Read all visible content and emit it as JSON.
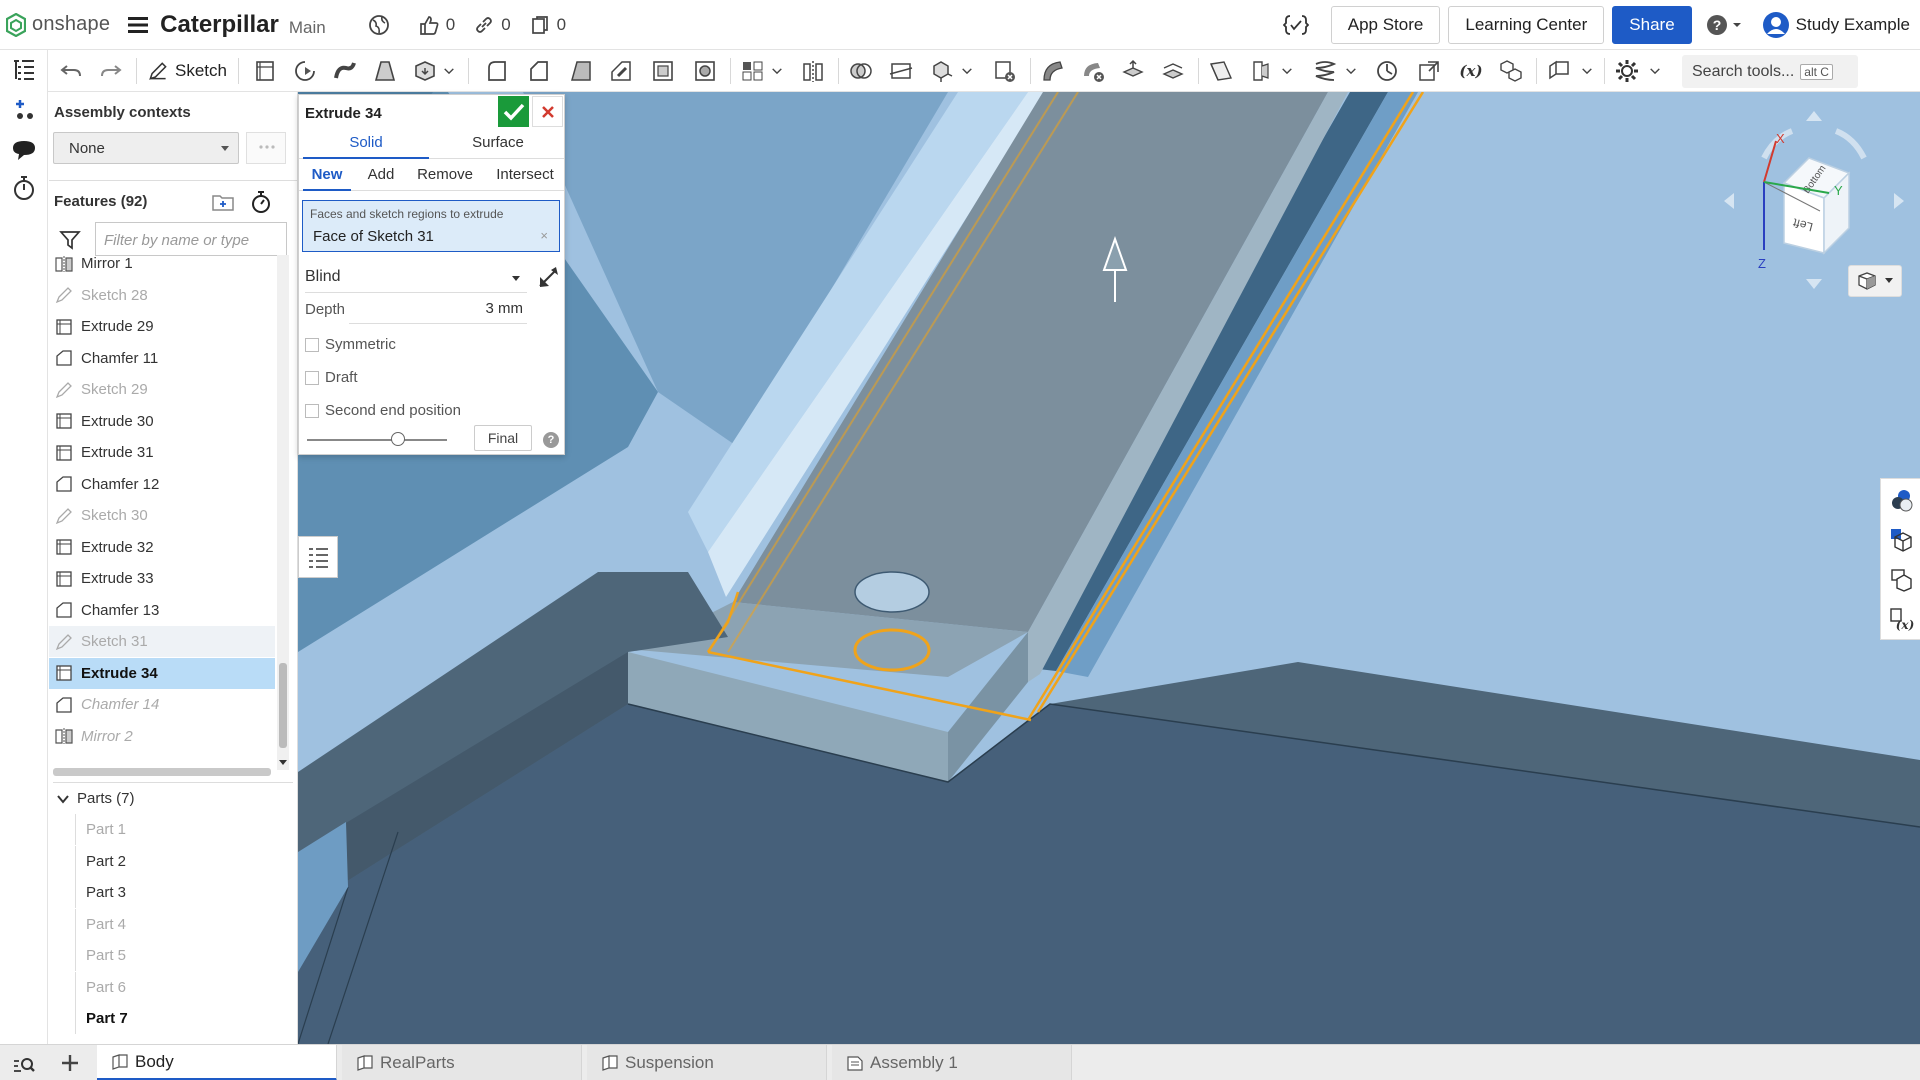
{
  "app": {
    "brand": "onshape",
    "doc_title": "Caterpillar",
    "branch": "Main"
  },
  "stats": {
    "likes": "0",
    "links": "0",
    "copies": "0"
  },
  "top_right": {
    "app_store": "App Store",
    "learning_center": "Learning Center",
    "share": "Share",
    "user": "Study Example"
  },
  "toolbar": {
    "sketch_label": "Sketch",
    "search_placeholder": "Search tools...",
    "search_shortcut": "alt C"
  },
  "panel": {
    "assembly_contexts_label": "Assembly contexts",
    "assembly_context_value": "None",
    "features_label": "Features (92)",
    "filter_placeholder": "Filter by name or type",
    "features": [
      {
        "name": "Mirror 1",
        "type": "mirror",
        "state": "normal"
      },
      {
        "name": "Sketch 28",
        "type": "sketch",
        "state": "suppressed"
      },
      {
        "name": "Extrude 29",
        "type": "extrude",
        "state": "normal"
      },
      {
        "name": "Chamfer 11",
        "type": "chamfer",
        "state": "normal"
      },
      {
        "name": "Sketch 29",
        "type": "sketch",
        "state": "suppressed"
      },
      {
        "name": "Extrude 30",
        "type": "extrude",
        "state": "normal"
      },
      {
        "name": "Extrude 31",
        "type": "extrude",
        "state": "normal"
      },
      {
        "name": "Chamfer 12",
        "type": "chamfer",
        "state": "normal"
      },
      {
        "name": "Sketch 30",
        "type": "sketch",
        "state": "suppressed"
      },
      {
        "name": "Extrude 32",
        "type": "extrude",
        "state": "normal"
      },
      {
        "name": "Extrude 33",
        "type": "extrude",
        "state": "normal"
      },
      {
        "name": "Chamfer 13",
        "type": "chamfer",
        "state": "normal"
      },
      {
        "name": "Sketch 31",
        "type": "sketch",
        "state": "hover"
      },
      {
        "name": "Extrude 34",
        "type": "extrude",
        "state": "selected"
      },
      {
        "name": "Chamfer 14",
        "type": "chamfer",
        "state": "rollback"
      },
      {
        "name": "Mirror 2",
        "type": "mirror",
        "state": "rollback"
      }
    ],
    "parts_label": "Parts (7)",
    "parts": [
      {
        "name": "Part 1",
        "state": "inactive"
      },
      {
        "name": "Part 2",
        "state": "active"
      },
      {
        "name": "Part 3",
        "state": "active"
      },
      {
        "name": "Part 4",
        "state": "inactive"
      },
      {
        "name": "Part 5",
        "state": "inactive"
      },
      {
        "name": "Part 6",
        "state": "inactive"
      },
      {
        "name": "Part 7",
        "state": "last"
      }
    ]
  },
  "dialog": {
    "title": "Extrude 34",
    "tab_solid": "Solid",
    "tab_surface": "Surface",
    "op_new": "New",
    "op_add": "Add",
    "op_remove": "Remove",
    "op_intersect": "Intersect",
    "faces_label": "Faces and sketch regions to extrude",
    "faces_value": "Face of Sketch 31",
    "clear_glyph": "×",
    "end_type": "Blind",
    "depth_label": "Depth",
    "depth_value": "3 mm",
    "symmetric_label": "Symmetric",
    "draft_label": "Draft",
    "second_end_label": "Second end position",
    "final_label": "Final",
    "help_glyph": "?"
  },
  "view_cube": {
    "x_label": "X",
    "y_label": "Y",
    "z_label": "Z",
    "face_top": "Bottom",
    "face_front": "Left"
  },
  "tabs": [
    {
      "label": "Body",
      "icon": "part-studio-icon",
      "active": true
    },
    {
      "label": "RealParts",
      "icon": "part-studio-icon",
      "active": false
    },
    {
      "label": "Suspension",
      "icon": "part-studio-icon",
      "active": false
    },
    {
      "label": "Assembly 1",
      "icon": "assembly-icon",
      "active": false
    }
  ],
  "colors": {
    "accent": "#1e5bc6",
    "ok": "#1a9a3a",
    "selected_row": "#b9dcf7",
    "highlight_edge": "#f0a31a",
    "viewport_bg": "#9fc1e0"
  }
}
